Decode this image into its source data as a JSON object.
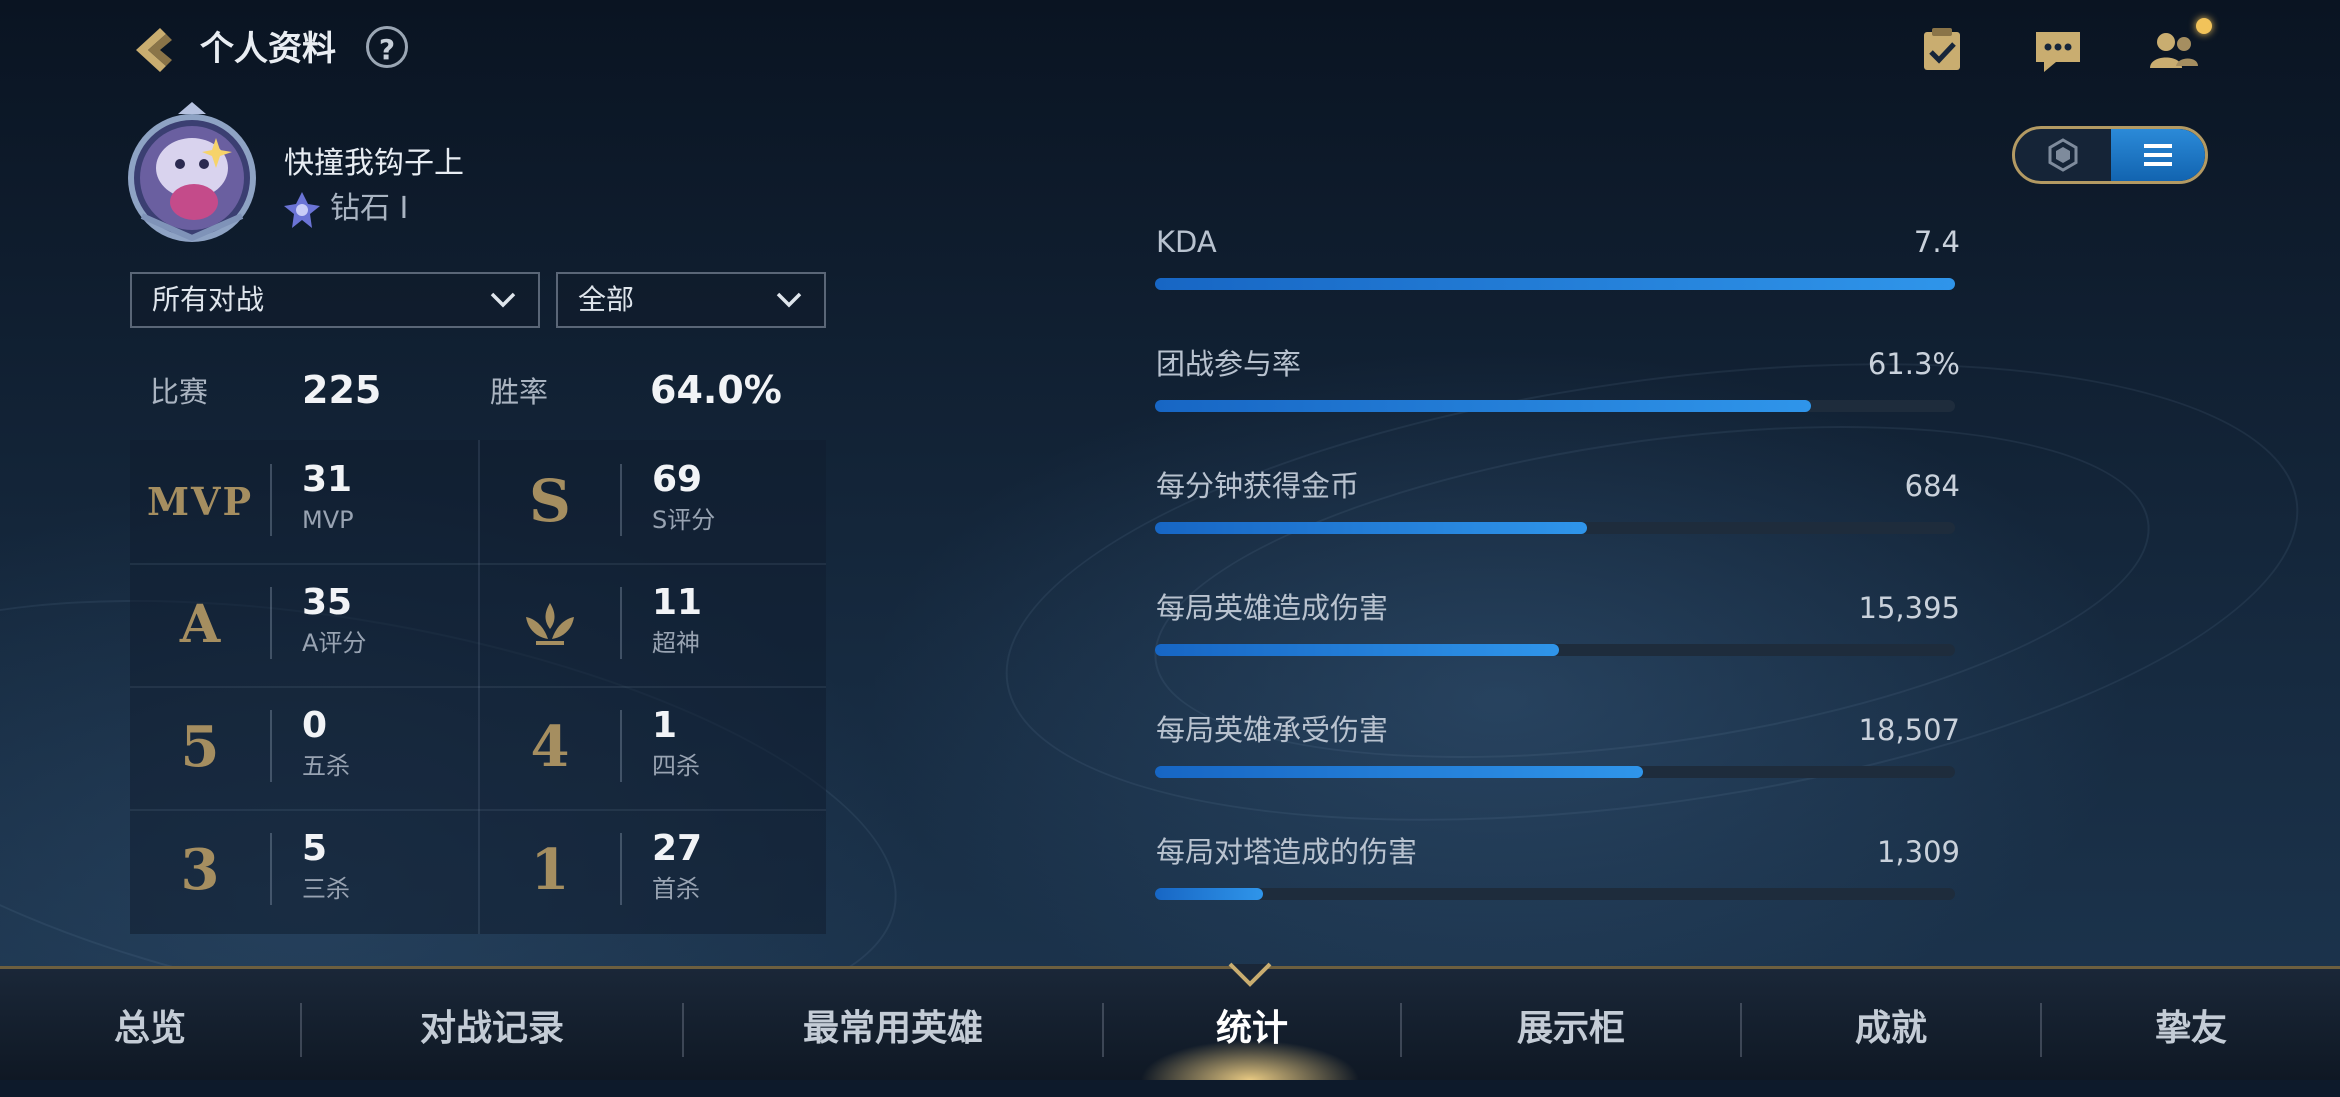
{
  "header": {
    "title": "个人资料",
    "help": "?"
  },
  "profile": {
    "name": "快撞我钩子上",
    "rank": "钻石 Ⅰ"
  },
  "filters": {
    "mode": "所有对战",
    "scope": "全部"
  },
  "summary": {
    "matches_label": "比赛",
    "matches": "225",
    "winrate_label": "胜率",
    "winrate": "64.0%"
  },
  "grid": [
    {
      "icon_text": "MVP",
      "icon_name": "mvp-icon",
      "value": "31",
      "caption": "MVP"
    },
    {
      "icon_text": "S",
      "icon_name": "s-rating-icon",
      "value": "69",
      "caption": "S评分"
    },
    {
      "icon_text": "A",
      "icon_name": "a-rating-icon",
      "value": "35",
      "caption": "A评分"
    },
    {
      "icon_text": "",
      "icon_name": "legendary-icon",
      "value": "11",
      "caption": "超神"
    },
    {
      "icon_text": "5",
      "icon_name": "penta-kill-icon",
      "value": "0",
      "caption": "五杀"
    },
    {
      "icon_text": "4",
      "icon_name": "quadra-kill-icon",
      "value": "1",
      "caption": "四杀"
    },
    {
      "icon_text": "3",
      "icon_name": "triple-kill-icon",
      "value": "5",
      "caption": "三杀"
    },
    {
      "icon_text": "1",
      "icon_name": "first-blood-icon",
      "value": "27",
      "caption": "首杀"
    }
  ],
  "stats": [
    {
      "label": "KDA",
      "value": "7.4",
      "fill": 1.0
    },
    {
      "label": "团战参与率",
      "value": "61.3%",
      "fill": 0.82
    },
    {
      "label": "每分钟获得金币",
      "value": "684",
      "fill": 0.54
    },
    {
      "label": "每局英雄造成伤害",
      "value": "15,395",
      "fill": 0.505
    },
    {
      "label": "每局英雄承受伤害",
      "value": "18,507",
      "fill": 0.61
    },
    {
      "label": "每局对塔造成的伤害",
      "value": "1,309",
      "fill": 0.135
    }
  ],
  "nav": [
    {
      "label": "总览"
    },
    {
      "label": "对战记录"
    },
    {
      "label": "最常用英雄"
    },
    {
      "label": "统计",
      "active": true
    },
    {
      "label": "展示柜"
    },
    {
      "label": "成就"
    },
    {
      "label": "挚友"
    }
  ],
  "colors": {
    "accent_blue": "#2f95ea",
    "gold": "#a58e60",
    "notify": "#f2c35a"
  }
}
